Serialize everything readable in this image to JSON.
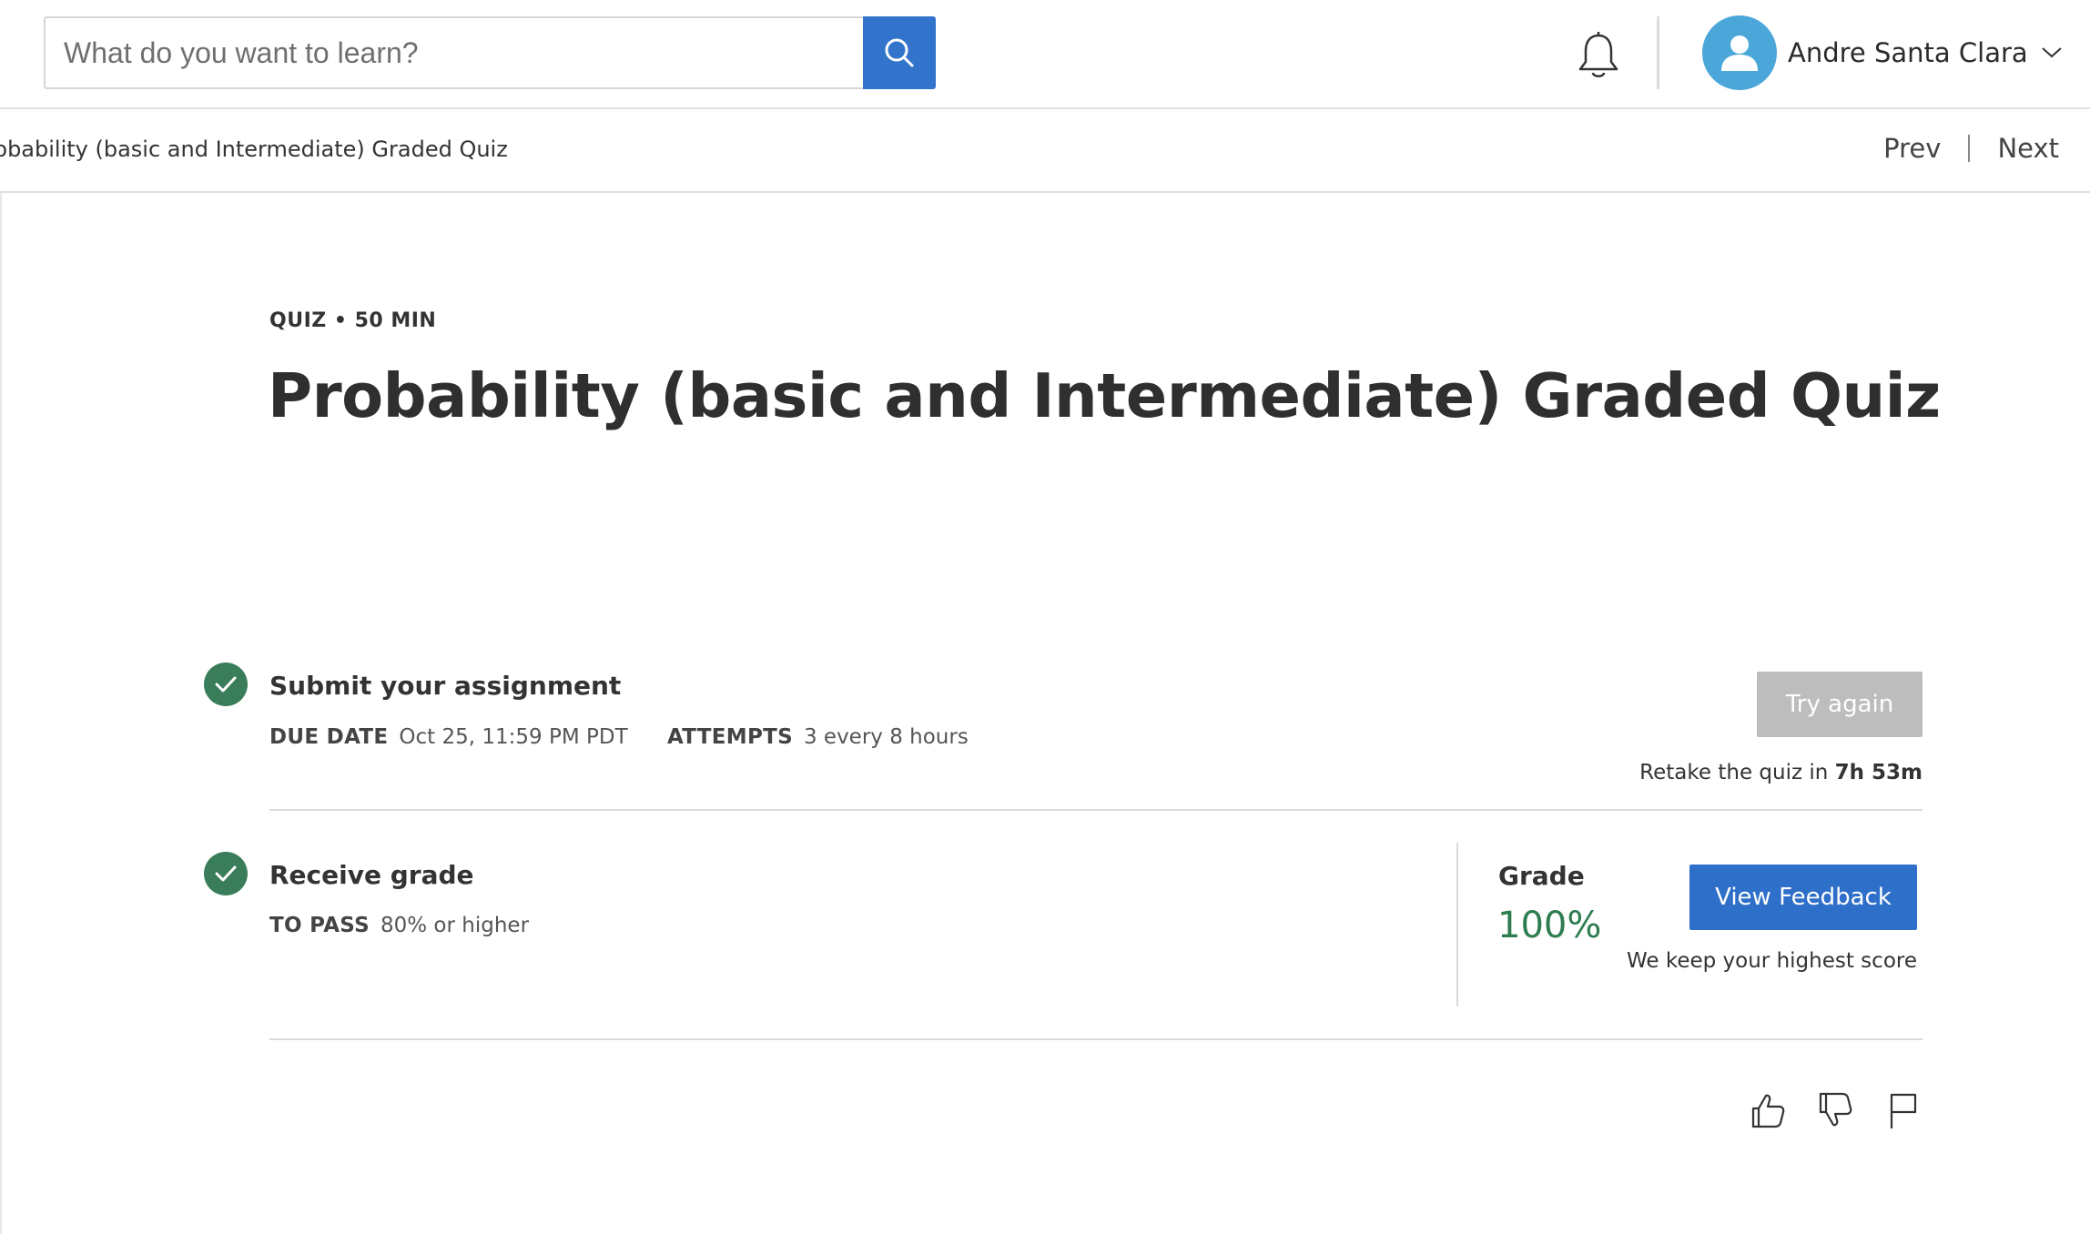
{
  "search": {
    "placeholder": "What do you want to learn?"
  },
  "user": {
    "name": "Andre Santa Clara"
  },
  "breadcrumb": {
    "current": "Probability (basic and Intermediate) Graded Quiz"
  },
  "nav": {
    "prev": "Prev",
    "next": "Next"
  },
  "quiz": {
    "meta": "QUIZ • 50 MIN",
    "title": "Probability (basic and Intermediate) Graded Quiz"
  },
  "submit": {
    "title": "Submit your assignment",
    "due_label": "DUE DATE",
    "due_value": "Oct 25, 11:59 PM PDT",
    "attempts_label": "ATTEMPTS",
    "attempts_value": "3 every 8 hours",
    "try_again": "Try again",
    "retake_prefix": "Retake the quiz in",
    "retake_time": "7h 53m"
  },
  "grade": {
    "title": "Receive grade",
    "pass_label": "TO PASS",
    "pass_value": "80% or higher",
    "grade_label": "Grade",
    "grade_value": "100%",
    "view_feedback": "View Feedback",
    "keep_note": "We keep your highest score"
  },
  "colors": {
    "accent": "#3274cc",
    "success": "#3a7d5a",
    "grade": "#2e7d51",
    "disabled": "#bdbdbd"
  },
  "icons": [
    "search-icon",
    "bell-icon",
    "user-icon",
    "chevron-down-icon",
    "check-icon",
    "thumbs-up-icon",
    "thumbs-down-icon",
    "flag-icon"
  ]
}
